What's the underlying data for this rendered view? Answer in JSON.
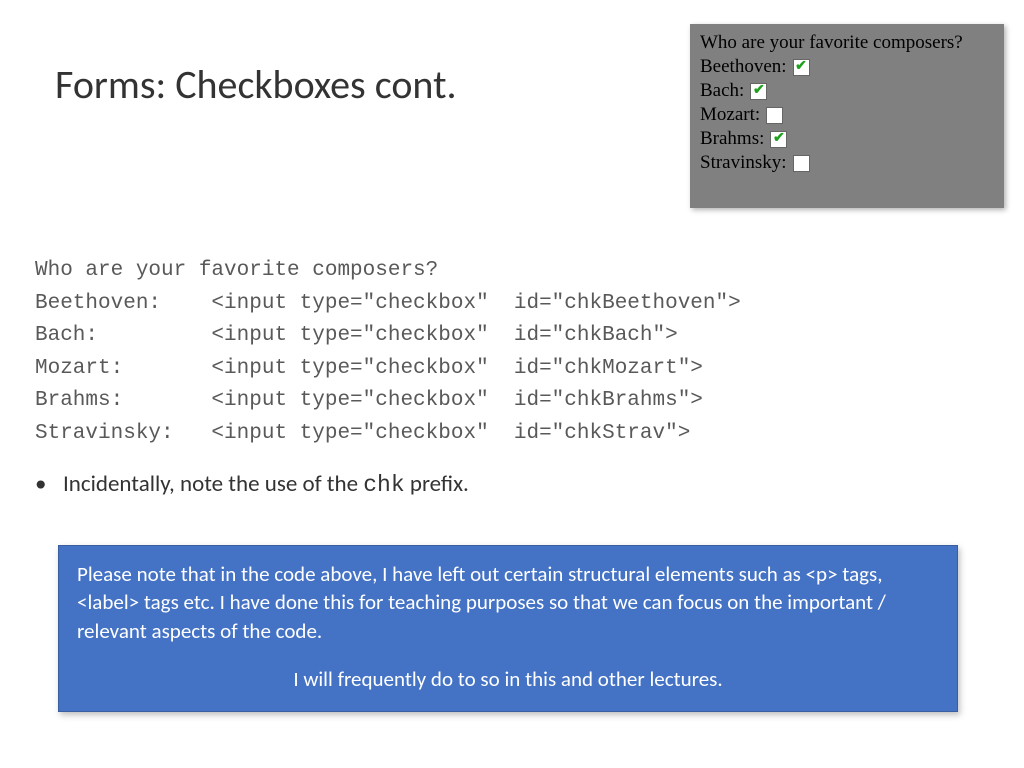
{
  "title": "Forms: Checkboxes cont.",
  "example": {
    "question": "Who are your favorite composers?",
    "rows": [
      {
        "label": "Beethoven:",
        "checked": true
      },
      {
        "label": "Bach:",
        "checked": true
      },
      {
        "label": "Mozart:",
        "checked": false
      },
      {
        "label": "Brahms:",
        "checked": true
      },
      {
        "label": "Stravinsky:",
        "checked": false
      }
    ]
  },
  "code": "Who are your favorite composers?\nBeethoven:    <input type=\"checkbox\"  id=\"chkBeethoven\">\nBach:         <input type=\"checkbox\"  id=\"chkBach\">\nMozart:       <input type=\"checkbox\"  id=\"chkMozart\">\nBrahms:       <input type=\"checkbox\"  id=\"chkBrahms\">\nStravinsky:   <input type=\"checkbox\"  id=\"chkStrav\">",
  "bullet": {
    "pre": "Incidentally, note the use of the ",
    "mono": "chk",
    "post": " prefix."
  },
  "note": {
    "para": "Please note that in the code above, I have left out certain structural elements such as <p> tags, <label> tags etc. I have done this for teaching purposes so that we can focus on the important / relevant aspects of the code.",
    "centered": "I will frequently do to so in this and other lectures."
  }
}
